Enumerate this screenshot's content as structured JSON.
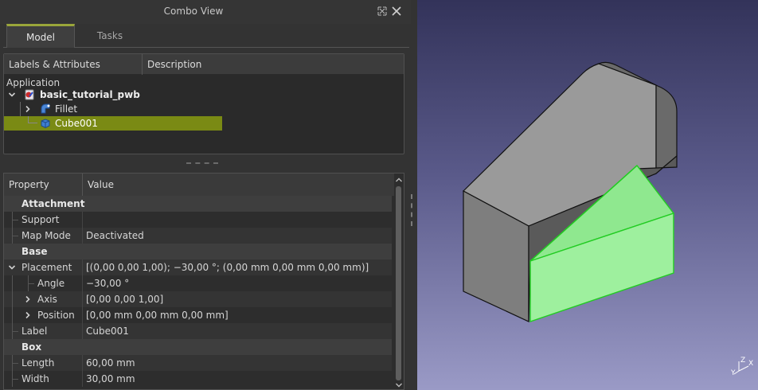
{
  "combo": {
    "title": "Combo View",
    "tabs": [
      {
        "label": "Model"
      },
      {
        "label": "Tasks"
      }
    ]
  },
  "tree": {
    "headers": {
      "labels": "Labels & Attributes",
      "description": "Description"
    },
    "application": "Application",
    "document": "basic_tutorial_pwb",
    "items": [
      {
        "label": "Fillet"
      },
      {
        "label": "Cube001"
      }
    ]
  },
  "properties": {
    "headers": {
      "property": "Property",
      "value": "Value"
    },
    "rows": [
      {
        "name": "Attachment",
        "value": ""
      },
      {
        "name": "Support",
        "value": ""
      },
      {
        "name": "Map Mode",
        "value": "Deactivated"
      },
      {
        "name": "Base",
        "value": ""
      },
      {
        "name": "Placement",
        "value": "[(0,00 0,00 1,00); −30,00 °; (0,00 mm  0,00 mm  0,00 mm)]"
      },
      {
        "name": "Angle",
        "value": "−30,00 °"
      },
      {
        "name": "Axis",
        "value": "[0,00 0,00 1,00]"
      },
      {
        "name": "Position",
        "value": "[0,00 mm  0,00 mm  0,00 mm]"
      },
      {
        "name": "Label",
        "value": "Cube001"
      },
      {
        "name": "Box",
        "value": ""
      },
      {
        "name": "Length",
        "value": "60,00 mm"
      },
      {
        "name": "Width",
        "value": "30,00 mm"
      }
    ]
  },
  "view": {
    "axis_labels": {
      "x": "X",
      "y": "Y",
      "z": "Z"
    },
    "colors": {
      "selection": "#9ef09e",
      "selection_edge": "#22cc22",
      "body": "#7a7a7a",
      "accent": "#9aa63a"
    }
  }
}
